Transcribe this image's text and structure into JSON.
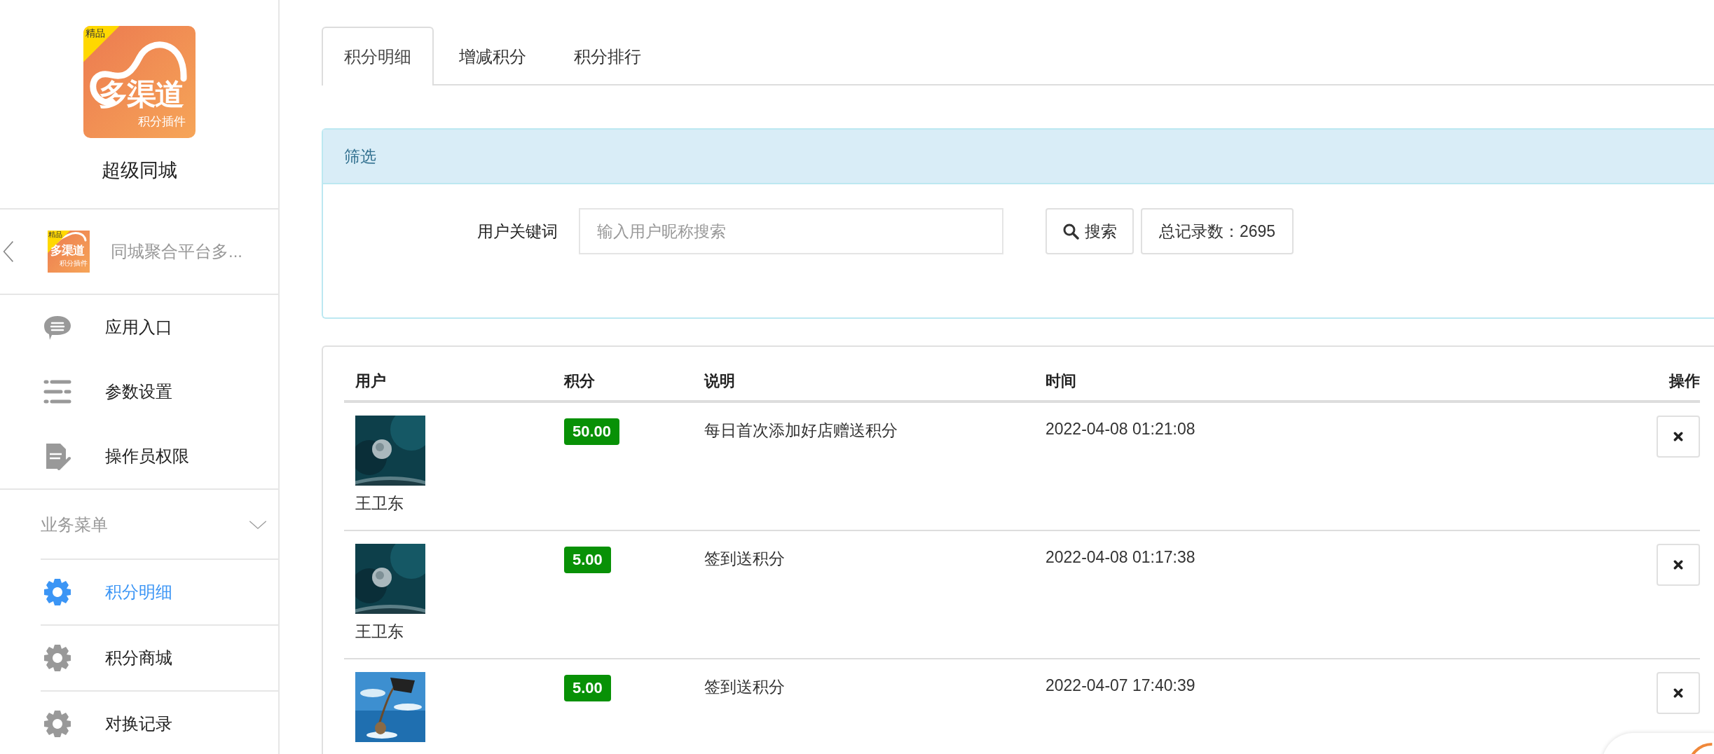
{
  "sidebar": {
    "logo": {
      "badge": "精品",
      "name": "多渠道",
      "subtitle": "积分插件"
    },
    "app_name": "超级同城",
    "plugin": {
      "title": "同城聚合平台多...",
      "logo": {
        "badge": "精品",
        "name": "多渠道",
        "subtitle": "积分插件"
      }
    },
    "items": [
      {
        "label": "应用入口",
        "selected": false
      },
      {
        "label": "参数设置",
        "selected": false
      },
      {
        "label": "操作员权限",
        "selected": false
      }
    ],
    "section": {
      "title": "业务菜单",
      "expanded": true,
      "items": [
        {
          "label": "积分明细",
          "selected": true
        },
        {
          "label": "积分商城",
          "selected": false
        },
        {
          "label": "对换记录",
          "selected": false
        }
      ]
    }
  },
  "tabs": [
    {
      "label": "积分明细",
      "selected": true
    },
    {
      "label": "增减积分",
      "selected": false
    },
    {
      "label": "积分排行",
      "selected": false
    }
  ],
  "filter": {
    "title": "筛选",
    "keyword_label": "用户关键词",
    "placeholder": "输入用户昵称搜索",
    "search_button": "搜索",
    "total": "总记录数：2695"
  },
  "table": {
    "columns": [
      "用户",
      "积分",
      "说明",
      "时间",
      "操作"
    ],
    "rows": [
      {
        "user": "王卫东",
        "points": "50.00",
        "description": "每日首次添加好店赠送积分",
        "time": "2022-04-08 01:21:08"
      },
      {
        "user": "王卫东",
        "points": "5.00",
        "description": "签到送积分",
        "time": "2022-04-08 01:17:38"
      },
      {
        "points": "5.00",
        "description": "签到送积分",
        "time": "2022-04-07 17:40:39"
      }
    ]
  }
}
